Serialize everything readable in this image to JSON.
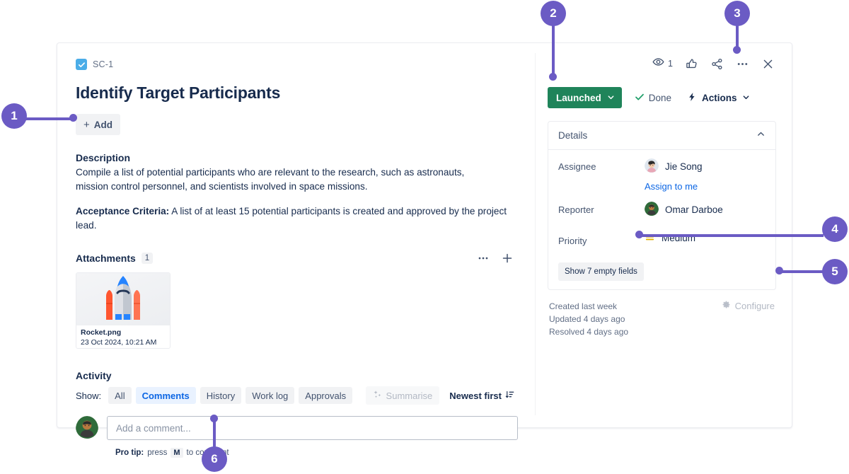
{
  "issue": {
    "key": "SC-1",
    "type_icon": "task-checkbox-icon",
    "title": "Identify Target Participants",
    "add_button": "Add",
    "description_heading": "Description",
    "description_body": "Compile a list of potential participants who are relevant to the research, such as astronauts, mission control personnel, and scientists involved in space missions.",
    "acceptance_label": "Acceptance Criteria:",
    "acceptance_body": " A list of at least 15 potential participants is created and approved by the project lead."
  },
  "attachments": {
    "heading": "Attachments",
    "count": "1",
    "items": [
      {
        "name": "Rocket.png",
        "date": "23 Oct 2024, 10:21 AM"
      }
    ],
    "more_icon": "ellipsis-icon",
    "add_icon": "plus-icon"
  },
  "activity": {
    "heading": "Activity",
    "show_label": "Show:",
    "tabs": [
      {
        "label": "All",
        "active": false
      },
      {
        "label": "Comments",
        "active": true
      },
      {
        "label": "History",
        "active": false
      },
      {
        "label": "Work log",
        "active": false
      },
      {
        "label": "Approvals",
        "active": false
      }
    ],
    "summarise_label": "Summarise",
    "summarise_icon": "sparkle-icon",
    "sort_label": "Newest first",
    "sort_icon": "sort-descending-icon",
    "comment_placeholder": "Add a comment...",
    "protip_prefix": "Pro tip:",
    "protip_press": "press",
    "protip_key": "M",
    "protip_suffix": "to comment"
  },
  "toolbar": {
    "watch_icon": "eye-icon",
    "watch_count": "1",
    "like_icon": "thumbs-up-icon",
    "share_icon": "share-icon",
    "more_icon": "ellipsis-icon",
    "close_icon": "close-icon"
  },
  "status": {
    "current": "Launched",
    "chevron_icon": "chevron-down-icon",
    "done_label": "Done",
    "done_icon": "check-icon",
    "actions_label": "Actions",
    "actions_icon": "lightning-bolt-icon",
    "color": "#1f845a"
  },
  "details": {
    "heading": "Details",
    "collapse_icon": "chevron-up-icon",
    "fields": [
      {
        "label": "Assignee",
        "value": "Jie Song",
        "avatar": "jie-song-avatar"
      },
      {
        "label": "Reporter",
        "value": "Omar Darboe",
        "avatar": "omar-darboe-avatar"
      },
      {
        "label": "Priority",
        "value": "Medium",
        "icon": "priority-medium-icon"
      }
    ],
    "assign_to_me": "Assign to me",
    "empty_fields_button": "Show 7 empty fields"
  },
  "meta": {
    "created": "Created last week",
    "updated": "Updated 4 days ago",
    "resolved": "Resolved 4 days ago",
    "configure_label": "Configure",
    "configure_icon": "gear-icon"
  },
  "callouts": [
    {
      "number": "1"
    },
    {
      "number": "2"
    },
    {
      "number": "3"
    },
    {
      "number": "4"
    },
    {
      "number": "5"
    },
    {
      "number": "6"
    }
  ],
  "colors": {
    "callout": "#6b5bc4",
    "status_green": "#1f845a",
    "link_blue": "#0c66e4",
    "active_chip_bg": "#e9f2ff"
  }
}
